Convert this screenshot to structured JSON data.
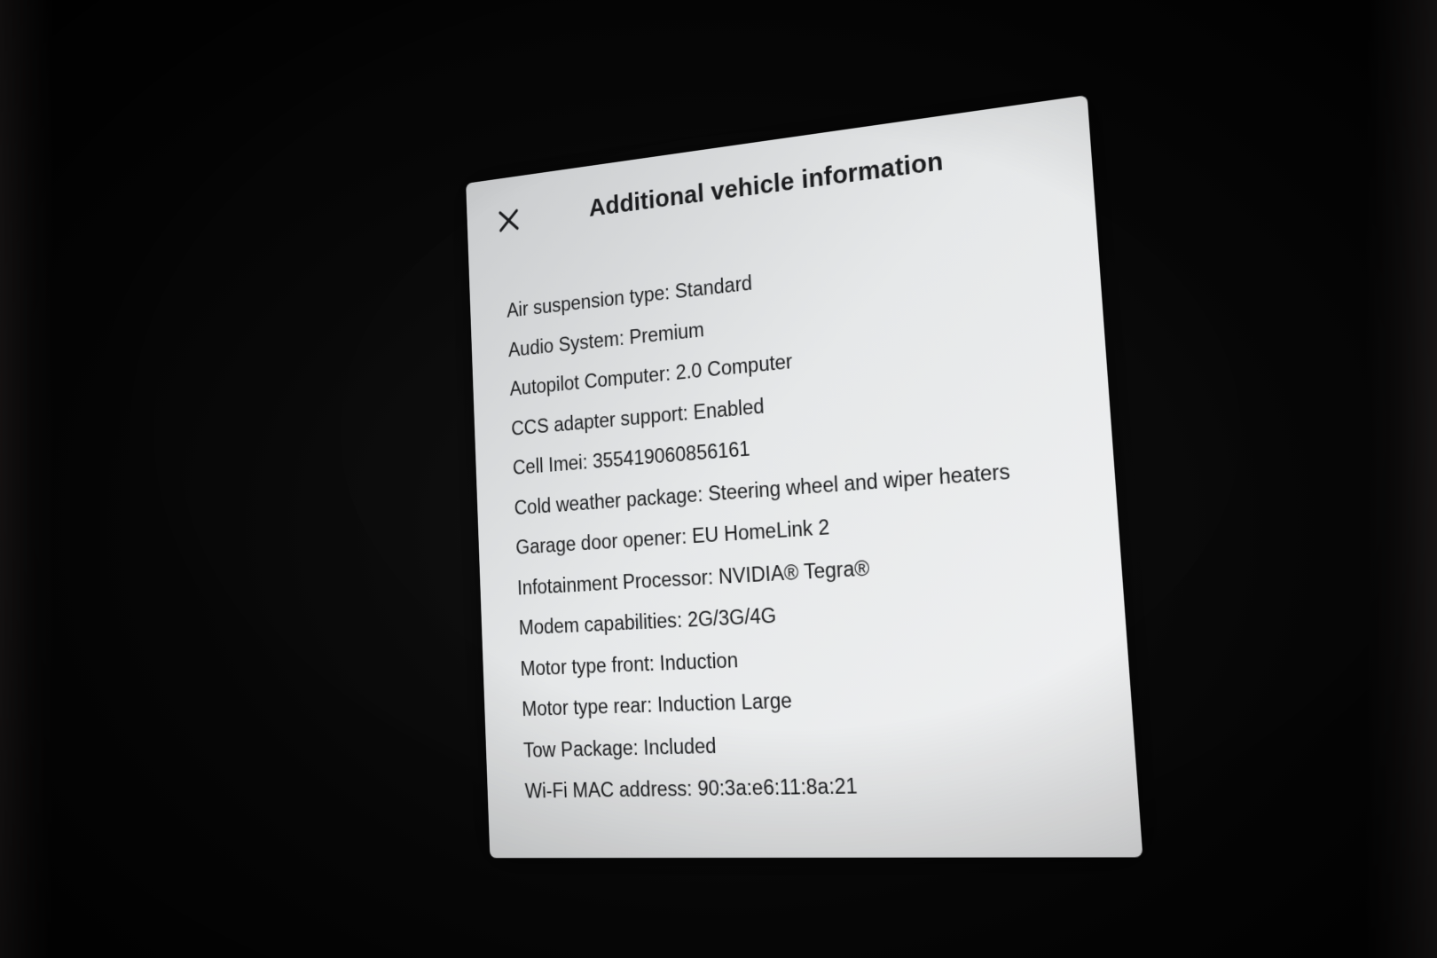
{
  "dialog": {
    "title": "Additional vehicle information",
    "close_icon": "close-icon",
    "items": [
      {
        "label": "Air suspension type",
        "value": "Standard"
      },
      {
        "label": "Audio System",
        "value": "Premium"
      },
      {
        "label": "Autopilot Computer",
        "value": "2.0 Computer"
      },
      {
        "label": "CCS adapter support",
        "value": "Enabled"
      },
      {
        "label": "Cell Imei",
        "value": "355419060856161"
      },
      {
        "label": "Cold weather package",
        "value": "Steering wheel and wiper heaters"
      },
      {
        "label": "Garage door opener",
        "value": "EU HomeLink 2"
      },
      {
        "label": "Infotainment Processor",
        "value": "NVIDIA® Tegra®"
      },
      {
        "label": "Modem capabilities",
        "value": "2G/3G/4G"
      },
      {
        "label": "Motor type front",
        "value": "Induction"
      },
      {
        "label": "Motor type rear",
        "value": "Induction Large"
      },
      {
        "label": "Tow Package",
        "value": "Included"
      },
      {
        "label": "Wi-Fi MAC address",
        "value": "90:3a:e6:11:8a:21"
      }
    ]
  }
}
